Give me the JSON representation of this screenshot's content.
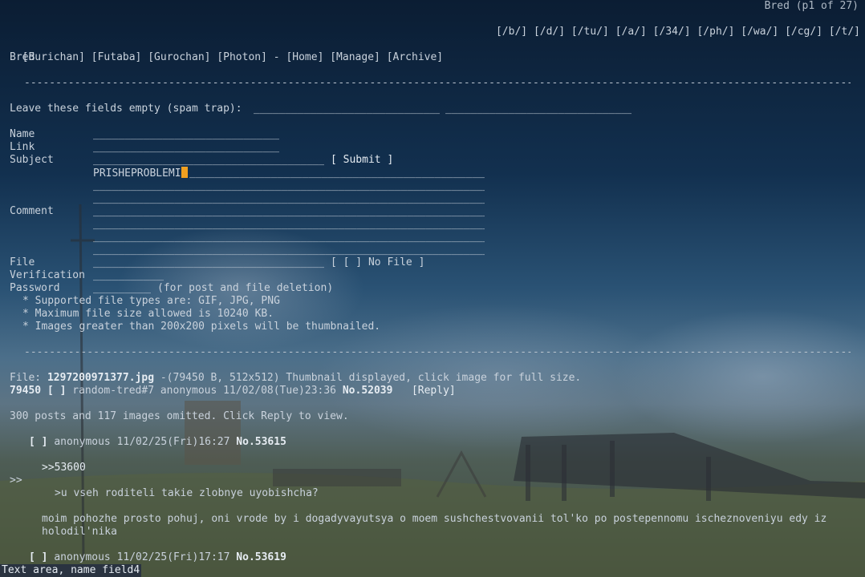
{
  "corner_title": "Bred (p1 of 27)",
  "boards": [
    "[/b/]",
    "[/d/]",
    "[/tu/]",
    "[/a/]",
    "[/34/]",
    "[/ph/]",
    "[/wa/]",
    "[/cg/]",
    "[/t/]"
  ],
  "site_nav": {
    "links": [
      "[Burichan]",
      "[Futaba]",
      "[Gurochan]",
      "[Photon]"
    ],
    "separator": "-",
    "right_links": [
      "[Home]",
      "[Manage]",
      "[Archive]"
    ]
  },
  "board_title": "Bred",
  "spam_trap_label": "Leave these fields empty (spam trap):",
  "form": {
    "name_label": "Name",
    "link_label": "Link",
    "subject_label": "Subject",
    "submit_label": "[ Submit ]",
    "comment_label": "Comment",
    "comment_value": "PRISHEPROBLEMI",
    "file_label": "File",
    "no_file_label": "[ [ ] No File ]",
    "verification_label": "Verification",
    "password_label": "Password",
    "password_note": "(for post and file deletion)",
    "rules": [
      "* Supported file types are: GIF, JPG, PNG",
      "* Maximum file size allowed is 10240 KB.",
      "* Images greater than 200x200 pixels will be thumbnailed."
    ]
  },
  "thread": {
    "file_prefix": "File:",
    "file_name": "1297200971377.jpg",
    "file_info": "-(79450 B, 512x512) Thumbnail displayed, click image for full size.",
    "op_id": "79450",
    "op_checkbox": "[ ]",
    "op_meta": "random-tred#7 anonymous 11/02/08(Tue)23:36",
    "op_no": "No.52039",
    "reply_link": "[Reply]",
    "omitted": "300 posts and 117 images omitted. Click Reply to view.",
    "replies": [
      {
        "checkbox": "[ ]",
        "meta": "anonymous 11/02/25(Fri)16:27",
        "no": "No.53615",
        "quote_link": ">>53600",
        "marker": ">>",
        "quote": ">u vseh roditeli takie zlobnye uyobishcha?",
        "text_line1": "moim pohozhe prosto pohuj, oni vrode by i dogadyvayutsya o moem sushchestvovanii tol'ko po postepennomu ischeznoveniyu edy iz",
        "text_line2": "holodil'nika"
      },
      {
        "checkbox": "[ ]",
        "meta": "anonymous 11/02/25(Fri)17:17",
        "no": "No.53619"
      }
    ]
  },
  "status_bar": "Text area, name field4"
}
